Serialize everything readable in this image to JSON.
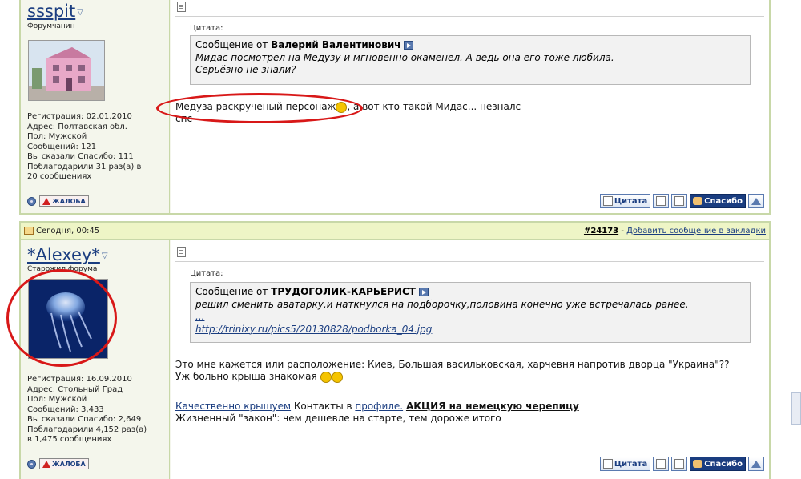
{
  "post1": {
    "username": "ssspit",
    "usertitle": "Форумчанин",
    "info": [
      "Регистрация: 02.01.2010",
      "Адрес: Полтавская обл.",
      "Пол: Мужской",
      "Сообщений: 121",
      "Вы сказали Спасибо: 111",
      "Поблагодарили 31 раз(а) в",
      "20 сообщениях"
    ],
    "report_label": "ЖАЛОБА",
    "quote": {
      "label": "Цитата:",
      "from_prefix": "Сообщение от",
      "author": "Валерий Валентинович",
      "lines": [
        "Мидас посмотрел на Медузу и мгновенно окаменел. А ведь она его тоже любила.",
        "Серьёзно не знали?"
      ]
    },
    "message": {
      "line1_a": "Медуза раскрученый персонаж",
      "line1_b": ", а вот кто такой Мидас... незналс",
      "line2": "спс"
    },
    "buttons": {
      "quote": "Цитата",
      "thanks": "Спасибо"
    }
  },
  "post2": {
    "date": "Сегодня, 00:45",
    "post_number": "#24173",
    "post_number_prefix": "#",
    "post_number_digits": "24173",
    "bookmark_sep": " - ",
    "bookmark_link": "Добавить сообщение в закладки",
    "username": "*Alexey*",
    "usertitle": "Старожил форума",
    "info": [
      "Регистрация: 16.09.2010",
      "Адрес: Стольный Град",
      "Пол: Мужской",
      "Сообщений: 3,433",
      "Вы сказали Спасибо: 2,649",
      "Поблагодарили 4,152 раз(а)",
      "в 1,475 сообщениях"
    ],
    "report_label": "ЖАЛОБА",
    "quote": {
      "label": "Цитата:",
      "from_prefix": "Сообщение от",
      "author": "ТРУДОГОЛИК-КАРЬЕРИСТ",
      "line1": "решил сменить аватарку,и наткнулся на подборочку,половина конечно уже встречалась ранее.",
      "ellipsis": "...",
      "link": "http://trinixy.ru/pics5/20130828/podborka_04.jpg"
    },
    "message": {
      "line1": "Это мне кажется или расположение: Киев, Большая васильковская, харчевня напротив дворца \"Украина\"??",
      "line2": "Уж больно крыша знакомая"
    },
    "signature": {
      "link1": "Качественно крышуем",
      "text1": " Контакты в ",
      "link2": "профиле.",
      "space": " ",
      "link3": "АКЦИЯ на немецкую черепицу",
      "line2": "Жизненный \"закон\": чем дешевле на старте, тем дороже итого"
    },
    "buttons": {
      "quote": "Цитата",
      "thanks": "Спасибо"
    }
  },
  "colors": {
    "accent": "#1a3d80",
    "post_border": "#c8d8a8",
    "header_bg": "#eef5c6",
    "annotation_red": "#d81818"
  }
}
